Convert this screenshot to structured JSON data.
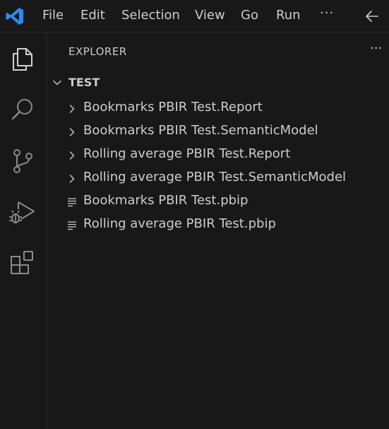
{
  "menu": {
    "file": "File",
    "edit": "Edit",
    "selection": "Selection",
    "view": "View",
    "go": "Go",
    "run": "Run",
    "more": "···"
  },
  "activity_bar": {
    "items": [
      {
        "icon": "files-icon"
      },
      {
        "icon": "search-icon"
      },
      {
        "icon": "source-control-icon"
      },
      {
        "icon": "run-debug-icon"
      },
      {
        "icon": "extensions-icon"
      }
    ]
  },
  "explorer": {
    "title": "EXPLORER",
    "more": "···",
    "folder": {
      "label": "TEST",
      "expanded": true
    },
    "items": [
      {
        "label": "Bookmarks PBIR Test.Report",
        "kind": "folder"
      },
      {
        "label": "Bookmarks PBIR Test.SemanticModel",
        "kind": "folder"
      },
      {
        "label": "Rolling average PBIR Test.Report",
        "kind": "folder"
      },
      {
        "label": "Rolling average PBIR Test.SemanticModel",
        "kind": "folder"
      },
      {
        "label": "Bookmarks PBIR Test.pbip",
        "kind": "file"
      },
      {
        "label": "Rolling average PBIR Test.pbip",
        "kind": "file"
      }
    ]
  },
  "colors": {
    "background": "#181818",
    "foreground": "#cccccc",
    "accent": "#2a8cf2",
    "border": "#2b2b2b"
  }
}
